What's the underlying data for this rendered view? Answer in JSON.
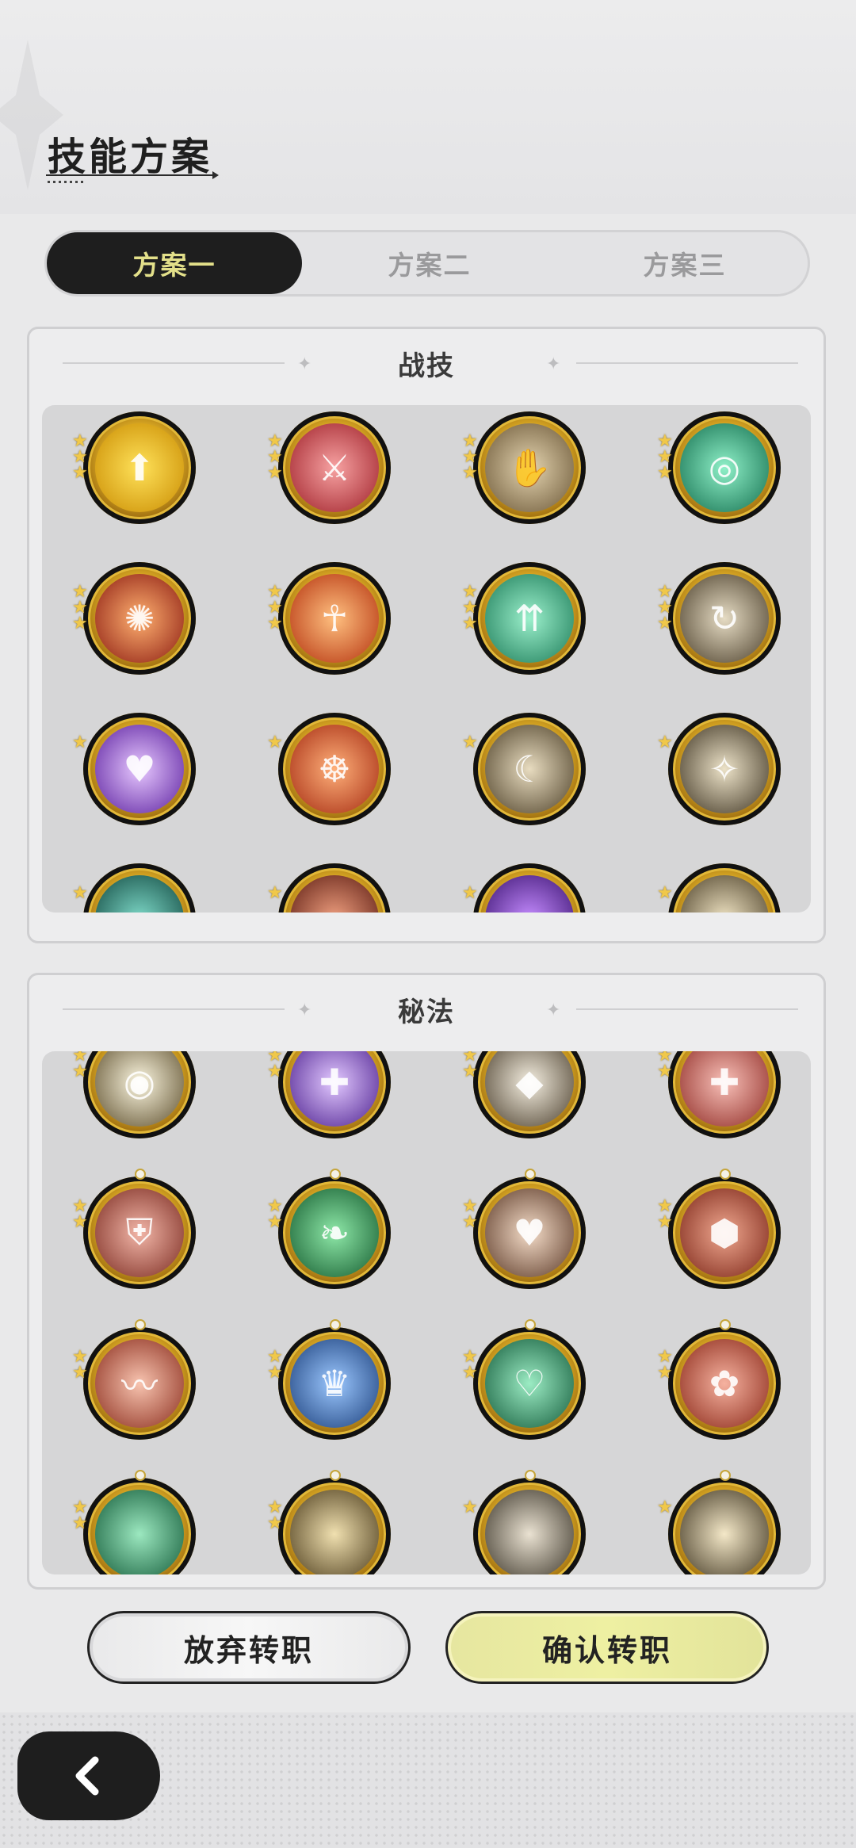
{
  "header": {
    "title": "技能方案"
  },
  "tabs": [
    {
      "label": "方案一",
      "active": true
    },
    {
      "label": "方案二",
      "active": false
    },
    {
      "label": "方案三",
      "active": false
    }
  ],
  "sections": {
    "combat": {
      "title": "战技"
    },
    "secret": {
      "title": "秘法"
    }
  },
  "buttons": {
    "abandon": "放弃转职",
    "confirm": "确认转职",
    "back": "back-arrow-icon"
  },
  "colors": {
    "accent_dark": "#1e1e1e",
    "accent_yellow": "#e3e08a",
    "confirm_bg": "#e9eaa0"
  }
}
